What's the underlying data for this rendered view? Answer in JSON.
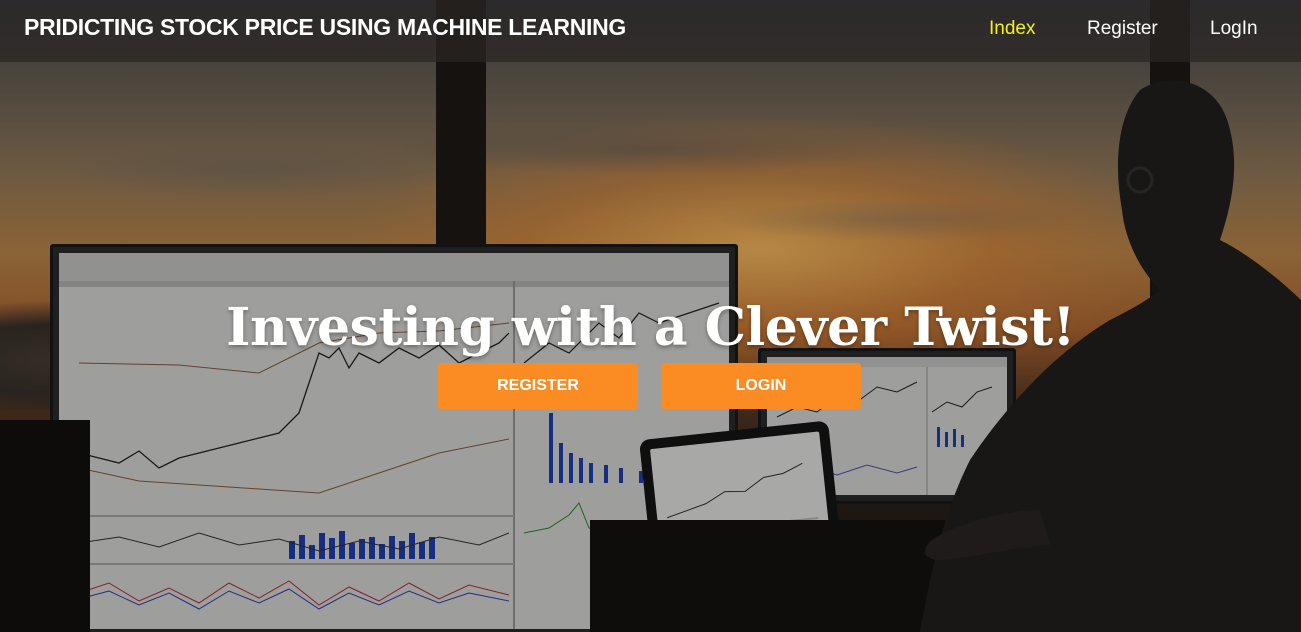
{
  "navbar": {
    "brand": "PRIDICTING STOCK PRICE USING MACHINE LEARNING",
    "links": [
      "Index",
      "Register",
      "LogIn"
    ],
    "active_color": "#f4f21a"
  },
  "hero": {
    "title": "Investing with a Clever Twist!",
    "buttons": {
      "register": "REGISTER",
      "login": "LOGIN"
    },
    "button_color": "#fb8c24"
  },
  "background": {
    "description_icon": "trading-desk-photo"
  }
}
